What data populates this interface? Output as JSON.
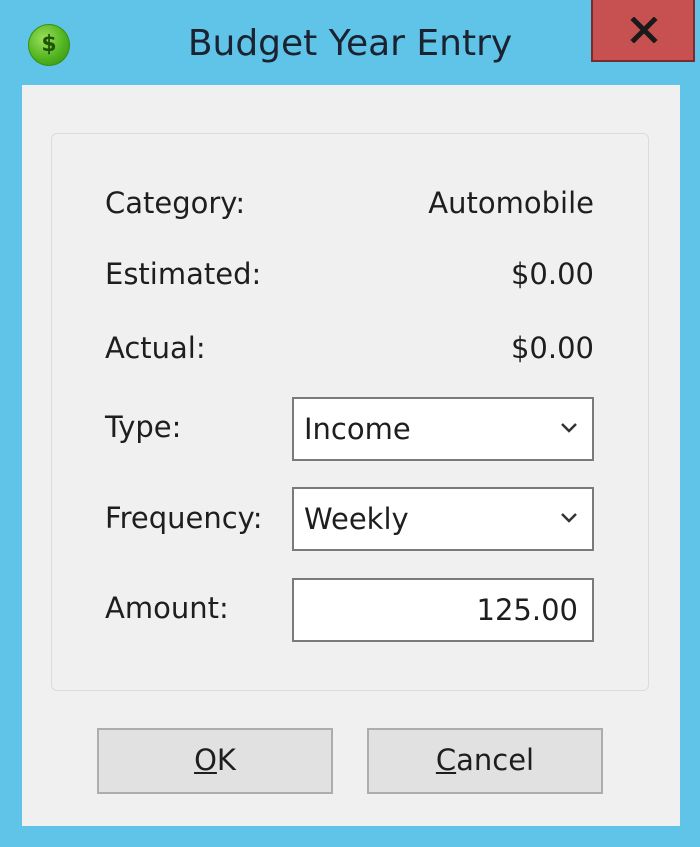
{
  "window": {
    "title": "Budget Year Entry",
    "icon": "dollar-coin-icon",
    "icon_glyph": "$",
    "close_glyph": "close-icon"
  },
  "form": {
    "category": {
      "label": "Category:",
      "value": "Automobile"
    },
    "estimated": {
      "label": "Estimated:",
      "value": "$0.00"
    },
    "actual": {
      "label": "Actual:",
      "value": "$0.00"
    },
    "type": {
      "label": "Type:",
      "value": "Income"
    },
    "frequency": {
      "label": "Frequency:",
      "value": "Weekly"
    },
    "amount": {
      "label": "Amount:",
      "value": "125.00"
    }
  },
  "buttons": {
    "ok": {
      "mnemonic": "O",
      "rest": "K"
    },
    "cancel": {
      "mnemonic": "C",
      "rest": "ancel"
    }
  },
  "colors": {
    "frame": "#5fc4e8",
    "close": "#c75050",
    "client": "#f0f0f0"
  }
}
